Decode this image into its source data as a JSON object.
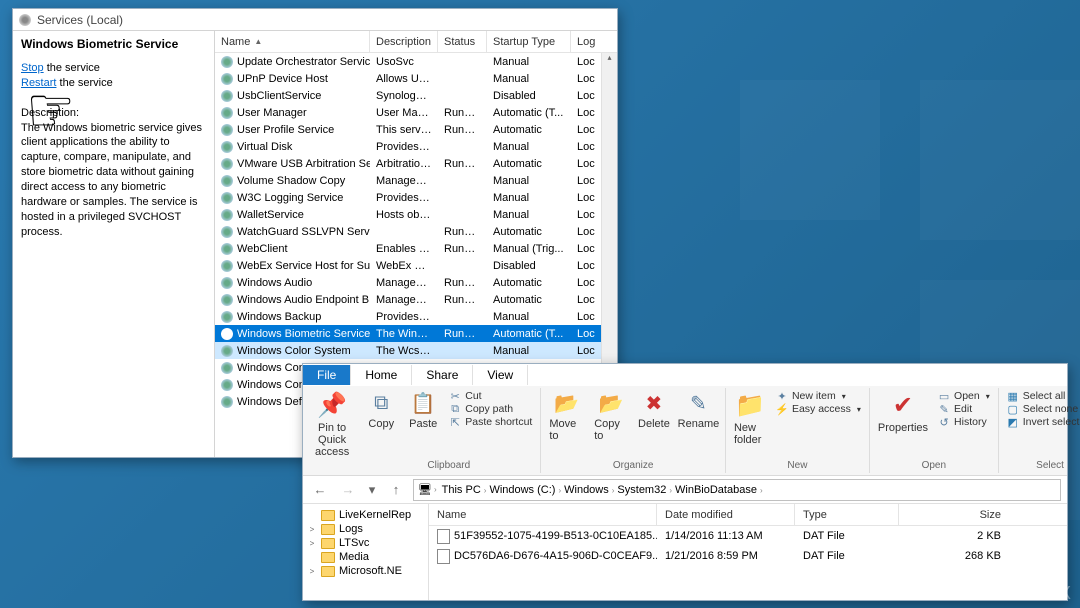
{
  "services": {
    "title": "Services (Local)",
    "selected_name": "Windows Biometric Service",
    "stop_label": "Stop",
    "stop_rest": " the service",
    "restart_label": "Restart",
    "restart_rest": " the service",
    "desc_label": "Description:",
    "desc_text": "The Windows biometric service gives client applications the ability to capture, compare, manipulate, and store biometric data without gaining direct access to any biometric hardware or samples. The service is hosted in a privileged SVCHOST process.",
    "columns": {
      "name": "Name",
      "description": "Description",
      "status": "Status",
      "startup": "Startup Type",
      "logon": "Log"
    },
    "rows": [
      {
        "name": "Update Orchestrator Service",
        "desc": "UsoSvc",
        "status": "",
        "startup": "Manual",
        "log": "Loc"
      },
      {
        "name": "UPnP Device Host",
        "desc": "Allows UPn...",
        "status": "",
        "startup": "Manual",
        "log": "Loc"
      },
      {
        "name": "UsbClientService",
        "desc": "Synology R...",
        "status": "",
        "startup": "Disabled",
        "log": "Loc"
      },
      {
        "name": "User Manager",
        "desc": "User Manag...",
        "status": "Running",
        "startup": "Automatic (T...",
        "log": "Loc"
      },
      {
        "name": "User Profile Service",
        "desc": "This service ...",
        "status": "Running",
        "startup": "Automatic",
        "log": "Loc"
      },
      {
        "name": "Virtual Disk",
        "desc": "Provides m...",
        "status": "",
        "startup": "Manual",
        "log": "Loc"
      },
      {
        "name": "VMware USB Arbitration Ser...",
        "desc": "Arbitration ...",
        "status": "Running",
        "startup": "Automatic",
        "log": "Loc"
      },
      {
        "name": "Volume Shadow Copy",
        "desc": "Manages an...",
        "status": "",
        "startup": "Manual",
        "log": "Loc"
      },
      {
        "name": "W3C Logging Service",
        "desc": "Provides W...",
        "status": "",
        "startup": "Manual",
        "log": "Loc"
      },
      {
        "name": "WalletService",
        "desc": "Hosts objec...",
        "status": "",
        "startup": "Manual",
        "log": "Loc"
      },
      {
        "name": "WatchGuard SSLVPN Service",
        "desc": "",
        "status": "Running",
        "startup": "Automatic",
        "log": "Loc"
      },
      {
        "name": "WebClient",
        "desc": "Enables Win...",
        "status": "Running",
        "startup": "Manual (Trig...",
        "log": "Loc"
      },
      {
        "name": "WebEx Service Host for Sup...",
        "desc": "WebEx Sup...",
        "status": "",
        "startup": "Disabled",
        "log": "Loc"
      },
      {
        "name": "Windows Audio",
        "desc": "Manages au...",
        "status": "Running",
        "startup": "Automatic",
        "log": "Loc"
      },
      {
        "name": "Windows Audio Endpoint B...",
        "desc": "Manages au...",
        "status": "Running",
        "startup": "Automatic",
        "log": "Loc"
      },
      {
        "name": "Windows Backup",
        "desc": "Provides Wi...",
        "status": "",
        "startup": "Manual",
        "log": "Loc"
      },
      {
        "name": "Windows Biometric Service",
        "desc": "The Windo...",
        "status": "Running",
        "startup": "Automatic (T...",
        "log": "Loc",
        "selected": true
      },
      {
        "name": "Windows Color System",
        "desc": "The WcsPlu...",
        "status": "",
        "startup": "Manual",
        "log": "Loc",
        "highlighted": true
      },
      {
        "name": "Windows Conn",
        "desc": "",
        "status": "",
        "startup": "",
        "log": ""
      },
      {
        "name": "Windows Conn",
        "desc": "",
        "status": "",
        "startup": "",
        "log": ""
      },
      {
        "name": "Windows Defen",
        "desc": "",
        "status": "",
        "startup": "",
        "log": ""
      }
    ]
  },
  "explorer": {
    "tabs": {
      "file": "File",
      "home": "Home",
      "share": "Share",
      "view": "View"
    },
    "ribbon": {
      "pin": "Pin to Quick access",
      "copy": "Copy",
      "paste": "Paste",
      "cut": "Cut",
      "copy_path": "Copy path",
      "paste_shortcut": "Paste shortcut",
      "clipboard": "Clipboard",
      "move_to": "Move to",
      "copy_to": "Copy to",
      "delete": "Delete",
      "rename": "Rename",
      "organize": "Organize",
      "new_folder": "New folder",
      "new_item": "New item",
      "easy_access": "Easy access",
      "new": "New",
      "properties": "Properties",
      "open": "Open",
      "edit": "Edit",
      "history": "History",
      "open_group": "Open",
      "select_all": "Select all",
      "select_none": "Select none",
      "invert": "Invert selection",
      "select": "Select"
    },
    "breadcrumbs": [
      "This PC",
      "Windows (C:)",
      "Windows",
      "System32",
      "WinBioDatabase"
    ],
    "tree": [
      {
        "name": "LiveKernelRep",
        "caret": ""
      },
      {
        "name": "Logs",
        "caret": ">"
      },
      {
        "name": "LTSvc",
        "caret": ">"
      },
      {
        "name": "Media",
        "caret": ""
      },
      {
        "name": "Microsoft.NE",
        "caret": ">"
      }
    ],
    "file_columns": {
      "name": "Name",
      "date": "Date modified",
      "type": "Type",
      "size": "Size"
    },
    "files": [
      {
        "name": "51F39552-1075-4199-B513-0C10EA185...",
        "date": "1/14/2016 11:13 AM",
        "type": "DAT File",
        "size": "2 KB"
      },
      {
        "name": "DC576DA6-D676-4A15-906D-C0CEAF9...",
        "date": "1/21/2016 8:59 PM",
        "type": "DAT File",
        "size": "268 KB"
      }
    ]
  },
  "watermark": "UGETFIX"
}
